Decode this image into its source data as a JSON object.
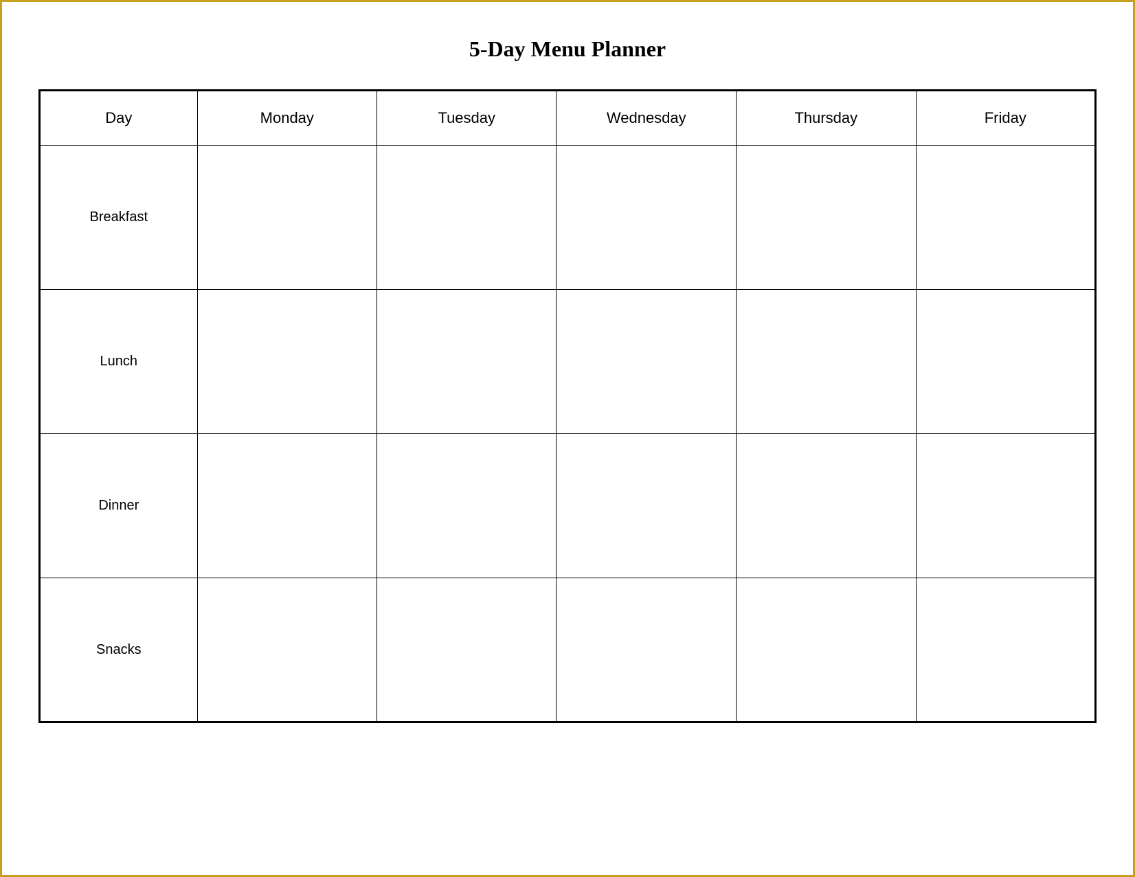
{
  "title": "5-Day Menu Planner",
  "table": {
    "headers": [
      "Day",
      "Monday",
      "Tuesday",
      "Wednesday",
      "Thursday",
      "Friday"
    ],
    "rows": [
      {
        "label": "Breakfast",
        "cells": [
          "",
          "",
          "",
          "",
          ""
        ]
      },
      {
        "label": "Lunch",
        "cells": [
          "",
          "",
          "",
          "",
          ""
        ]
      },
      {
        "label": "Dinner",
        "cells": [
          "",
          "",
          "",
          "",
          ""
        ]
      },
      {
        "label": "Snacks",
        "cells": [
          "",
          "",
          "",
          "",
          ""
        ]
      }
    ]
  }
}
